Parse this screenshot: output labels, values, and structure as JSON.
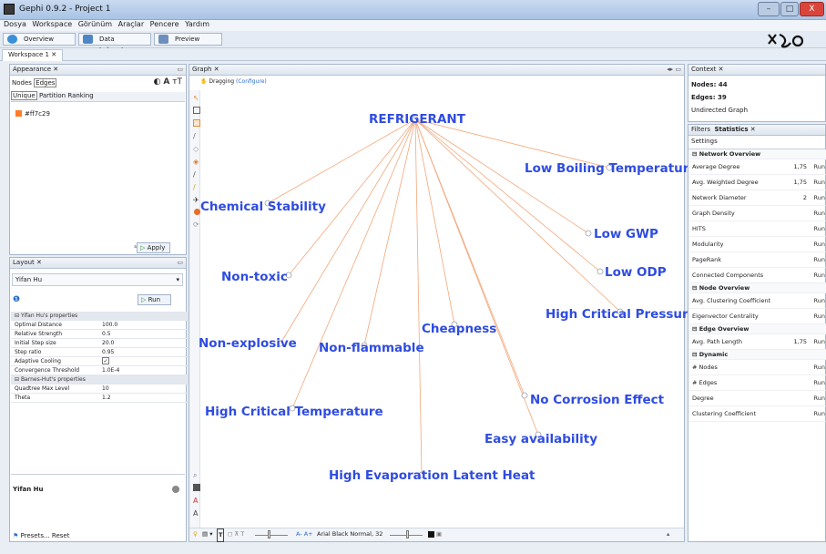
{
  "window": {
    "title": "Gephi 0.9.2 - Project 1",
    "minimize": "–",
    "maximize": "□",
    "close": "X"
  },
  "menu": [
    "Dosya",
    "Workspace",
    "Görünüm",
    "Araçlar",
    "Pencere",
    "Yardım"
  ],
  "top_tabs": [
    {
      "label": "Overview",
      "color": "#3a8fd8"
    },
    {
      "label": "Data Laboratory",
      "color": "#4f87c6"
    },
    {
      "label": "Preview",
      "color": "#6d8fbd"
    }
  ],
  "workspace_tab": "Workspace 1",
  "appearance": {
    "title": "Appearance",
    "tabs": [
      "Nodes",
      "Edges"
    ],
    "subtabs": [
      "Unique",
      "Partition",
      "Ranking"
    ],
    "color_value": "#ff7c29",
    "apply": "Apply"
  },
  "layout_panel": {
    "title": "Layout",
    "algorithm": "Yifan Hu",
    "run": "Run",
    "sections": {
      "yifan": "Yifan Hu's properties",
      "barnes": "Barnes-Hut's properties"
    },
    "properties": [
      {
        "k": "Optimal Distance",
        "v": "100.0"
      },
      {
        "k": "Relative Strength",
        "v": "0.5"
      },
      {
        "k": "Initial Step size",
        "v": "20.0"
      },
      {
        "k": "Step ratio",
        "v": "0.95"
      },
      {
        "k": "Adaptive Cooling",
        "v": "✓"
      },
      {
        "k": "Convergence Threshold",
        "v": "1.0E-4"
      },
      {
        "k": "Quadtree Max Level",
        "v": "10"
      },
      {
        "k": "Theta",
        "v": "1.2"
      }
    ],
    "footer_name": "Yifan Hu",
    "presets": "Presets...",
    "reset": "Reset"
  },
  "graph": {
    "title": "Graph",
    "mode": "Dragging",
    "configure": "(Configure)",
    "font_label": "Arial Black Normal, 32",
    "hub": "REFRIGERANT",
    "nodes": [
      "Low Boiling Temperature",
      "Chemical Stability",
      "Low GWP",
      "Low ODP",
      "Non-toxic",
      "High Critical Pressure",
      "Cheapness",
      "Non-explosive",
      "Non-flammable",
      "No Corrosion Effect",
      "High Critical Temperature",
      "Easy availability",
      "High Evaporation Latent Heat"
    ],
    "edge_color": "#f3a77a",
    "label_color": "#2f4ce0"
  },
  "context": {
    "title": "Context",
    "nodes": "Nodes: 44",
    "edges": "Edges: 39",
    "type": "Undirected Graph"
  },
  "statistics": {
    "tabs": [
      "Filters",
      "Statistics"
    ],
    "settings": "Settings",
    "rows": [
      {
        "name": "Network Overview",
        "section": true
      },
      {
        "name": "Average Degree",
        "value": "1,75",
        "run": "Run"
      },
      {
        "name": "Avg. Weighted Degree",
        "value": "1,75",
        "run": "Run"
      },
      {
        "name": "Network Diameter",
        "value": "2",
        "run": "Run"
      },
      {
        "name": "Graph Density",
        "value": "",
        "run": "Run"
      },
      {
        "name": "HITS",
        "value": "",
        "run": "Run"
      },
      {
        "name": "Modularity",
        "value": "",
        "run": "Run"
      },
      {
        "name": "PageRank",
        "value": "",
        "run": "Run"
      },
      {
        "name": "Connected Components",
        "value": "",
        "run": "Run"
      },
      {
        "name": "Node Overview",
        "section": true
      },
      {
        "name": "Avg. Clustering Coefficient",
        "value": "",
        "run": "Run"
      },
      {
        "name": "Eigenvector Centrality",
        "value": "",
        "run": "Run"
      },
      {
        "name": "Edge Overview",
        "section": true
      },
      {
        "name": "Avg. Path Length",
        "value": "1,75",
        "run": "Run"
      },
      {
        "name": "Dynamic",
        "section": true
      },
      {
        "name": "# Nodes",
        "value": "",
        "run": "Run"
      },
      {
        "name": "# Edges",
        "value": "",
        "run": "Run"
      },
      {
        "name": "Degree",
        "value": "",
        "run": "Run"
      },
      {
        "name": "Clustering Coefficient",
        "value": "",
        "run": "Run"
      }
    ]
  }
}
